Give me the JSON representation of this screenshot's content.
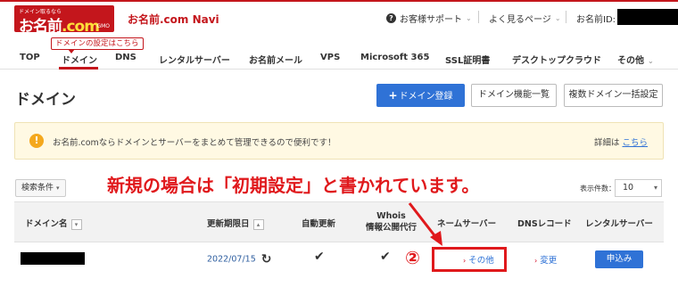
{
  "header": {
    "logo_small_text": "ドメイン取るなら",
    "logo_main": "お名前",
    "logo_dot": ".",
    "logo_com": "com",
    "logo_tm": "GMO",
    "navi_title": "お名前.com Navi",
    "support_label": "お客様サポート",
    "frequent_pages_label": "よく見るページ",
    "user_id_label": "お名前ID:"
  },
  "nav": {
    "callout": "ドメインの設定はこちら",
    "items": [
      {
        "label": "TOP"
      },
      {
        "label": "ドメイン"
      },
      {
        "label": "DNS"
      },
      {
        "label": "レンタルサーバー"
      },
      {
        "label": "お名前メール"
      },
      {
        "label": "VPS"
      },
      {
        "label": "Microsoft 365"
      },
      {
        "label": "SSL証明書"
      },
      {
        "label": "デスクトップクラウド"
      },
      {
        "label": "その他"
      }
    ]
  },
  "page": {
    "title": "ドメイン",
    "register_button": "ドメイン登録",
    "feature_list_button": "ドメイン機能一覧",
    "bulk_button": "複数ドメイン一括設定"
  },
  "notice": {
    "message": "お名前.comならドメインとサーバーをまとめて管理できるので便利です！",
    "detail_prefix": "詳細は",
    "detail_link": "こちら"
  },
  "toolbar": {
    "filter_label": "検索条件",
    "annotation": "新規の場合は「初期設定」と書かれています。",
    "per_page_label": "表示件数：",
    "per_page_value": "10"
  },
  "table": {
    "headers": {
      "domain": "ドメイン名",
      "expiry": "更新期限日",
      "auto_renew": "自動更新",
      "whois_line1": "Whois",
      "whois_line2": "情報公開代行",
      "nameserver": "ネームサーバー",
      "dns_record": "DNSレコード",
      "rental_server": "レンタルサーバー"
    },
    "rows": [
      {
        "expiry": "2022/07/15",
        "auto_renew": "✔",
        "whois": "✔",
        "nameserver": "その他",
        "dns_record": "変更",
        "rental_server": "申込み"
      }
    ]
  },
  "annotation_marker": "②",
  "colors": {
    "brand_red": "#c4161c",
    "primary_blue": "#2f72d6",
    "annotation_red": "#e0191c",
    "notice_bg": "#fff9e3",
    "warning_orange": "#f4a81d"
  },
  "icons": {
    "support": "question-circle-icon",
    "warning": "exclamation-circle-icon",
    "refresh": "refresh-icon",
    "check": "check-icon",
    "chevron": "chevron-down-icon",
    "link_arrow": "chevron-right-icon"
  }
}
